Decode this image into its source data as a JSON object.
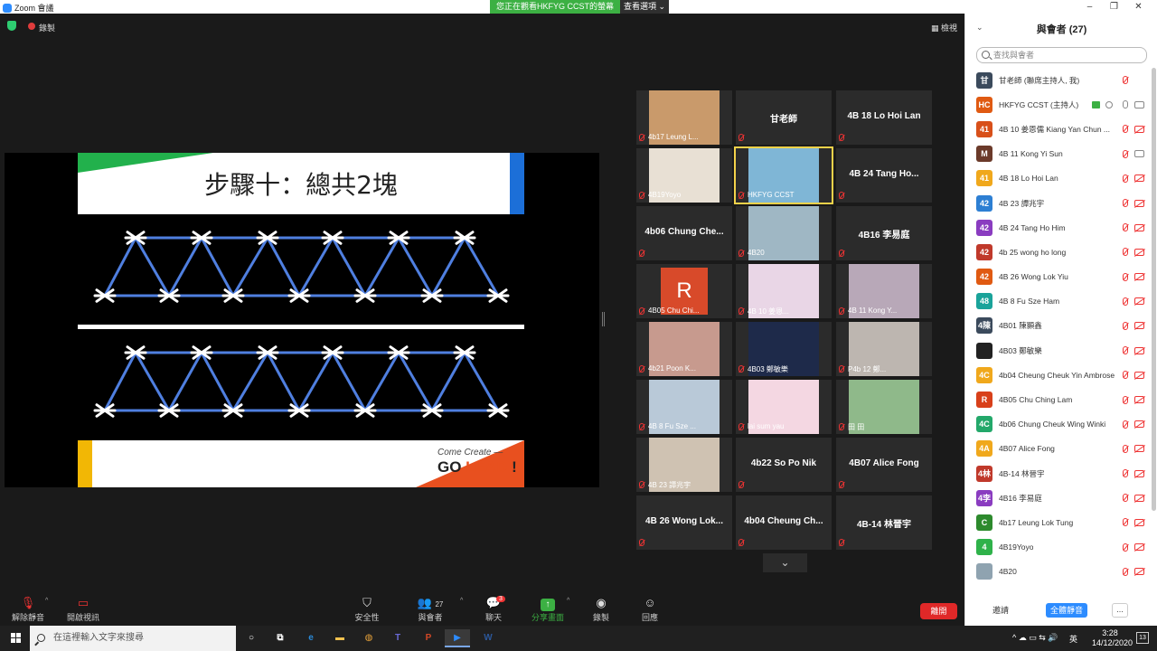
{
  "window": {
    "title": "Zoom 會議",
    "banner": "您正在觀看HKFYG CCST的螢幕",
    "view_options": "查看選項 ⌄"
  },
  "meeting_top": {
    "recording_label": "錄製",
    "view_label": "檢視"
  },
  "slide": {
    "title": "步驟十：總共2塊",
    "footer_line1": "Come Create —",
    "footer_line2_a": "GO ",
    "footer_line2_b": "LEAD",
    "footer_line2_c": " !"
  },
  "gallery": {
    "tiles": [
      {
        "name": "4b17 Leung L...",
        "type": "video",
        "bg": "#c99a6b"
      },
      {
        "name": "甘老師",
        "type": "name"
      },
      {
        "name": "4B 18 Lo Hoi Lan",
        "type": "name"
      },
      {
        "name": "4B19Yoyo",
        "type": "video",
        "bg": "#e8e0d4"
      },
      {
        "name": "HKFYG CCST",
        "type": "video",
        "bg": "#7fb6d6",
        "active": true
      },
      {
        "name": "4B 24 Tang Ho...",
        "type": "name"
      },
      {
        "name": "4b06 Chung Che...",
        "type": "name"
      },
      {
        "name": "4B20",
        "type": "video",
        "bg": "#9fb7c4"
      },
      {
        "name": "4B16 李易庭",
        "type": "name"
      },
      {
        "name": "4B05 Chu Chi...",
        "type": "video",
        "bg": "#d84a2a",
        "initial": "R"
      },
      {
        "name": "4B 10 姜恩...",
        "type": "video",
        "bg": "#e9d6e6"
      },
      {
        "name": "4B 11 Kong Y...",
        "type": "video",
        "bg": "#b8a8b8"
      },
      {
        "name": "4b21 Poon K...",
        "type": "video",
        "bg": "#c79a8e"
      },
      {
        "name": "4B03 鄭敏樂",
        "type": "video",
        "bg": "#1e2a4a"
      },
      {
        "name": "P4b 12 鄭...",
        "type": "video",
        "bg": "#bdb6b0"
      },
      {
        "name": "4B 8 Fu Sze ...",
        "type": "video",
        "bg": "#b9c9d8"
      },
      {
        "name": "lai sum yau",
        "type": "video",
        "bg": "#f4d7e2"
      },
      {
        "name": "田 田",
        "type": "video",
        "bg": "#8fb98a"
      },
      {
        "name": "4B 23 譚兆宇",
        "type": "video",
        "bg": "#cfc2b2"
      },
      {
        "name": "4b22 So Po Nik",
        "type": "name"
      },
      {
        "name": "4B07 Alice Fong",
        "type": "name"
      },
      {
        "name": "4B 26 Wong Lok...",
        "type": "name"
      },
      {
        "name": "4b04 Cheung Ch...",
        "type": "name"
      },
      {
        "name": "4B-14 林晉宇",
        "type": "name"
      }
    ],
    "down_arrow": "⌄"
  },
  "toolbar": {
    "unmute": "解除靜音",
    "start_video": "開啟視訊",
    "security": "安全性",
    "participants": "與會者",
    "participants_count": "27",
    "chat": "聊天",
    "chat_badge": "3",
    "share": "分享畫面",
    "record": "錄製",
    "reactions": "回應",
    "end": "離開"
  },
  "panel": {
    "title": "與會者 (27)",
    "search_placeholder": "查找與會者",
    "participants": [
      {
        "avatar": "甘",
        "color": "#3b4a5c",
        "name": "甘老師 (聯席主持人, 我)",
        "cam": "none"
      },
      {
        "avatar": "HC",
        "color": "#e05a12",
        "name": "HKFYG CCST (主持人)",
        "host": true,
        "mic": "on",
        "cam": "on"
      },
      {
        "avatar": "41",
        "color": "#d8501a",
        "name": "4B 10 姜恩儒  Kiang Yan Chun ..."
      },
      {
        "avatar": "M",
        "color": "#6b3a2a",
        "name": "4B 11 Kong Yi Sun",
        "cam": "on"
      },
      {
        "avatar": "41",
        "color": "#f0a81c",
        "name": "4B 18 Lo Hoi Lan"
      },
      {
        "avatar": "42",
        "color": "#2d7fd3",
        "name": "4B 23 譚兆宇"
      },
      {
        "avatar": "42",
        "color": "#8a3cc0",
        "name": "4B 24 Tang Ho Him"
      },
      {
        "avatar": "42",
        "color": "#c0392b",
        "name": "4b 25 wong ho long"
      },
      {
        "avatar": "42",
        "color": "#e05a12",
        "name": "4B 26 Wong Lok Yiu"
      },
      {
        "avatar": "48",
        "color": "#1aa39a",
        "name": "4B 8 Fu Sze Ham"
      },
      {
        "avatar": "4陳",
        "color": "#3b4a5c",
        "name": "4B01 陳顥鑫"
      },
      {
        "avatar": "",
        "color": "#222222",
        "name": "4B03 鄭敏樂"
      },
      {
        "avatar": "4C",
        "color": "#f0a81c",
        "name": "4b04 Cheung Cheuk Yin Ambrose"
      },
      {
        "avatar": "R",
        "color": "#d8401a",
        "name": "4B05 Chu Ching Lam"
      },
      {
        "avatar": "4C",
        "color": "#23a86a",
        "name": "4b06 Chung Cheuk Wing Winki"
      },
      {
        "avatar": "4A",
        "color": "#f0a81c",
        "name": "4B07 Alice Fong"
      },
      {
        "avatar": "4林",
        "color": "#c0392b",
        "name": "4B-14 林晉宇"
      },
      {
        "avatar": "4李",
        "color": "#8a3cc0",
        "name": "4B16 李易庭"
      },
      {
        "avatar": "C",
        "color": "#2d8a2d",
        "name": "4b17 Leung Lok Tung"
      },
      {
        "avatar": "4",
        "color": "#2fb24a",
        "name": "4B19Yoyo"
      },
      {
        "avatar": "",
        "color": "#8fa3b0",
        "name": "4B20"
      }
    ],
    "invite": "邀請",
    "mute_all": "全體靜音",
    "more": "..."
  },
  "taskbar": {
    "search_placeholder": "在這裡輸入文字來搜尋",
    "lang": "英",
    "time": "3:28",
    "date": "14/12/2020",
    "notif": "13"
  }
}
